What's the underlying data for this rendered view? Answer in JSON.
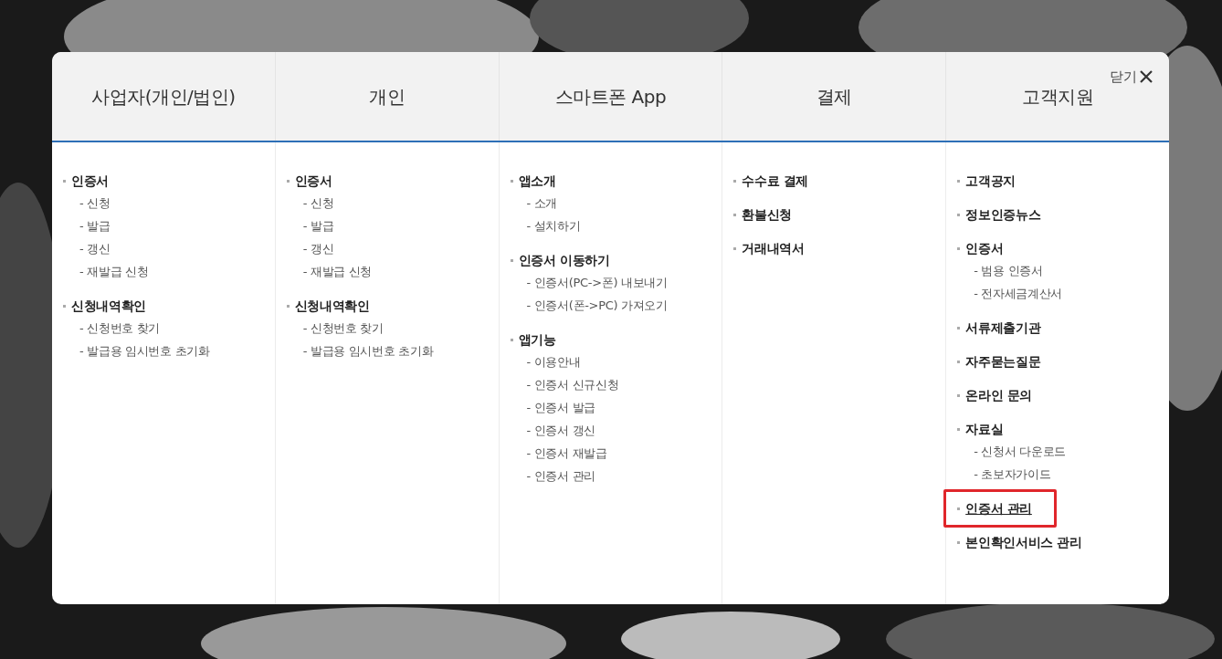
{
  "modal": {
    "close_label": "닫기",
    "columns": [
      {
        "title": "사업자(개인/법인)",
        "items": [
          {
            "label": "인증서",
            "highlighted": false,
            "children": [
              {
                "label": "- 신청"
              },
              {
                "label": "- 발급"
              },
              {
                "label": "- 갱신"
              },
              {
                "label": "- 재발급 신청"
              }
            ]
          },
          {
            "label": "신청내역확인",
            "highlighted": false,
            "children": [
              {
                "label": "- 신청번호 찾기"
              },
              {
                "label": "- 발급용 임시번호 초기화"
              }
            ]
          }
        ]
      },
      {
        "title": "개인",
        "items": [
          {
            "label": "인증서",
            "highlighted": false,
            "children": [
              {
                "label": "- 신청"
              },
              {
                "label": "- 발급"
              },
              {
                "label": "- 갱신"
              },
              {
                "label": "- 재발급 신청"
              }
            ]
          },
          {
            "label": "신청내역확인",
            "highlighted": false,
            "children": [
              {
                "label": "- 신청번호 찾기"
              },
              {
                "label": "- 발급용 임시번호 초기화"
              }
            ]
          }
        ]
      },
      {
        "title": "스마트폰 App",
        "items": [
          {
            "label": "앱소개",
            "highlighted": false,
            "children": [
              {
                "label": "- 소개"
              },
              {
                "label": "- 설치하기"
              }
            ]
          },
          {
            "label": "인증서 이동하기",
            "highlighted": false,
            "children": [
              {
                "label": "- 인증서(PC->폰) 내보내기"
              },
              {
                "label": "- 인증서(폰->PC) 가져오기"
              }
            ]
          },
          {
            "label": "앱기능",
            "highlighted": false,
            "children": [
              {
                "label": "- 이용안내"
              },
              {
                "label": "- 인증서 신규신청"
              },
              {
                "label": "- 인증서 발급"
              },
              {
                "label": "- 인증서 갱신"
              },
              {
                "label": "- 인증서 재발급"
              },
              {
                "label": "- 인증서 관리"
              }
            ]
          }
        ]
      },
      {
        "title": "결제",
        "items": [
          {
            "label": "수수료 결제",
            "highlighted": false
          },
          {
            "label": "환불신청",
            "highlighted": false
          },
          {
            "label": "거래내역서",
            "highlighted": false
          }
        ]
      },
      {
        "title": "고객지원",
        "items": [
          {
            "label": "고객공지",
            "highlighted": false
          },
          {
            "label": "정보인증뉴스",
            "highlighted": false
          },
          {
            "label": "인증서",
            "highlighted": false,
            "children": [
              {
                "label": "- 범용 인증서"
              },
              {
                "label": "- 전자세금계산서"
              }
            ]
          },
          {
            "label": "서류제출기관",
            "highlighted": false
          },
          {
            "label": "자주묻는질문",
            "highlighted": false
          },
          {
            "label": "온라인 문의",
            "highlighted": false
          },
          {
            "label": "자료실",
            "highlighted": false,
            "children": [
              {
                "label": "- 신청서 다운로드"
              },
              {
                "label": "- 초보자가이드"
              }
            ]
          },
          {
            "label": "인증서 관리",
            "highlighted": true
          },
          {
            "label": "본인확인서비스 관리",
            "highlighted": false
          }
        ]
      }
    ]
  }
}
